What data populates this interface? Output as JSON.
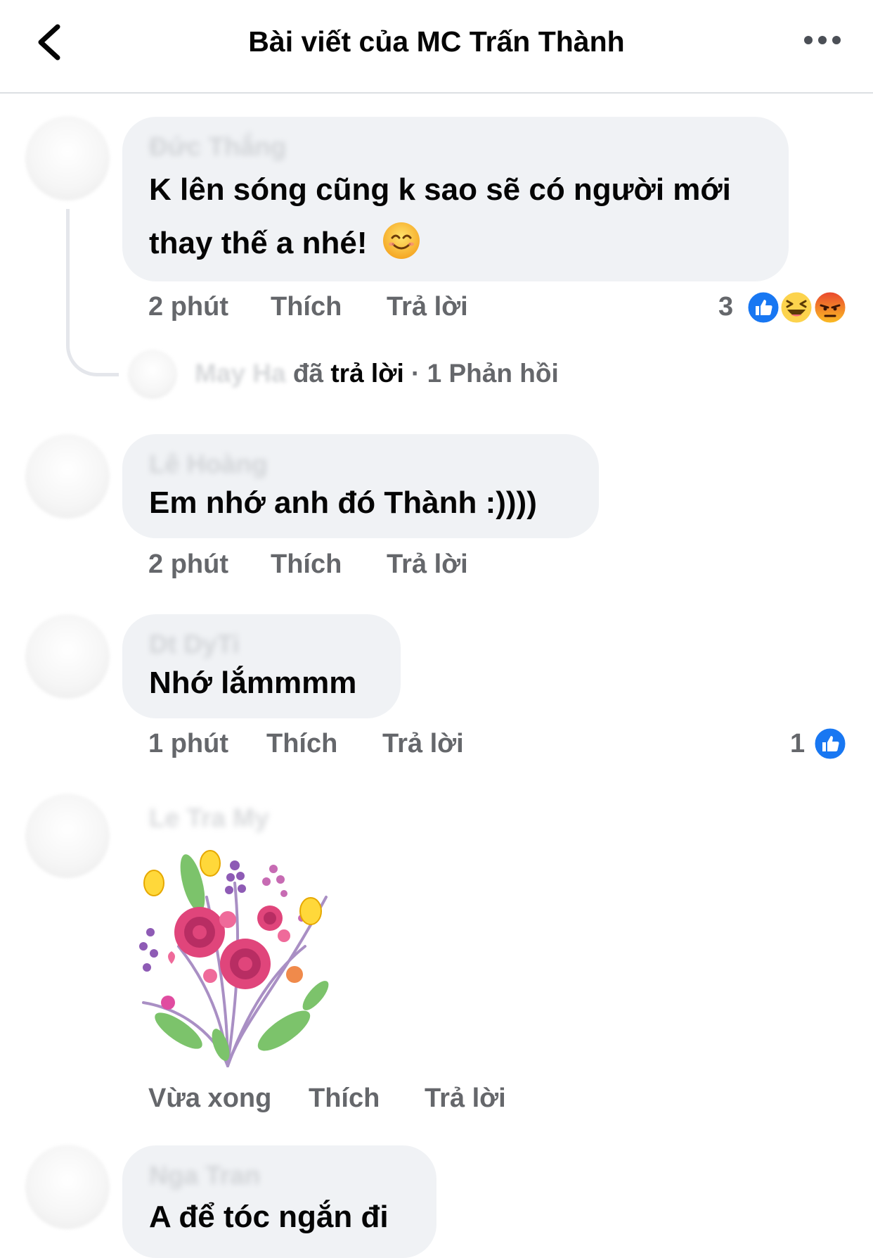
{
  "header": {
    "title": "Bài viết của MC Trấn Thành"
  },
  "icons": {
    "back": "chevron-left-icon",
    "more": "more-horizontal-icon"
  },
  "comments": [
    {
      "author": "Đức Thắng",
      "lines": [
        "K lên sóng cũng k sao sẽ có người mới",
        "thay thế a nhé!"
      ],
      "emoji": "smiling-face-emoji",
      "time": "2 phút",
      "like": "Thích",
      "reply": "Trả lời",
      "reaction_count": "3",
      "reactions": [
        "like-reaction-icon",
        "haha-reaction-icon",
        "angry-reaction-icon"
      ]
    },
    {
      "author": "Lê Hoàng",
      "text": "Em nhớ anh đó Thành :))))",
      "time": "2 phút",
      "like": "Thích",
      "reply": "Trả lời"
    },
    {
      "author": "Dt DyTi",
      "text": "Nhớ lắmmmm",
      "time": "1 phút",
      "like": "Thích",
      "reply": "Trả lời",
      "reaction_count": "1",
      "reactions": [
        "like-reaction-icon"
      ]
    },
    {
      "author": "Le Tra My",
      "sticker": "flower-bouquet-sticker",
      "time": "Vừa xong",
      "like": "Thích",
      "reply": "Trả lời"
    },
    {
      "author": "Nga Tran",
      "text": "A để tóc ngắn đi"
    }
  ],
  "reply_summary": {
    "name": "May Ha",
    "verb_prefix": "đã",
    "verb": "trả lời",
    "count_text": "· 1 Phản hồi"
  },
  "colors": {
    "like_blue": "#1877f2",
    "meta_gray": "#65676b",
    "bubble_bg": "#f0f2f5"
  }
}
